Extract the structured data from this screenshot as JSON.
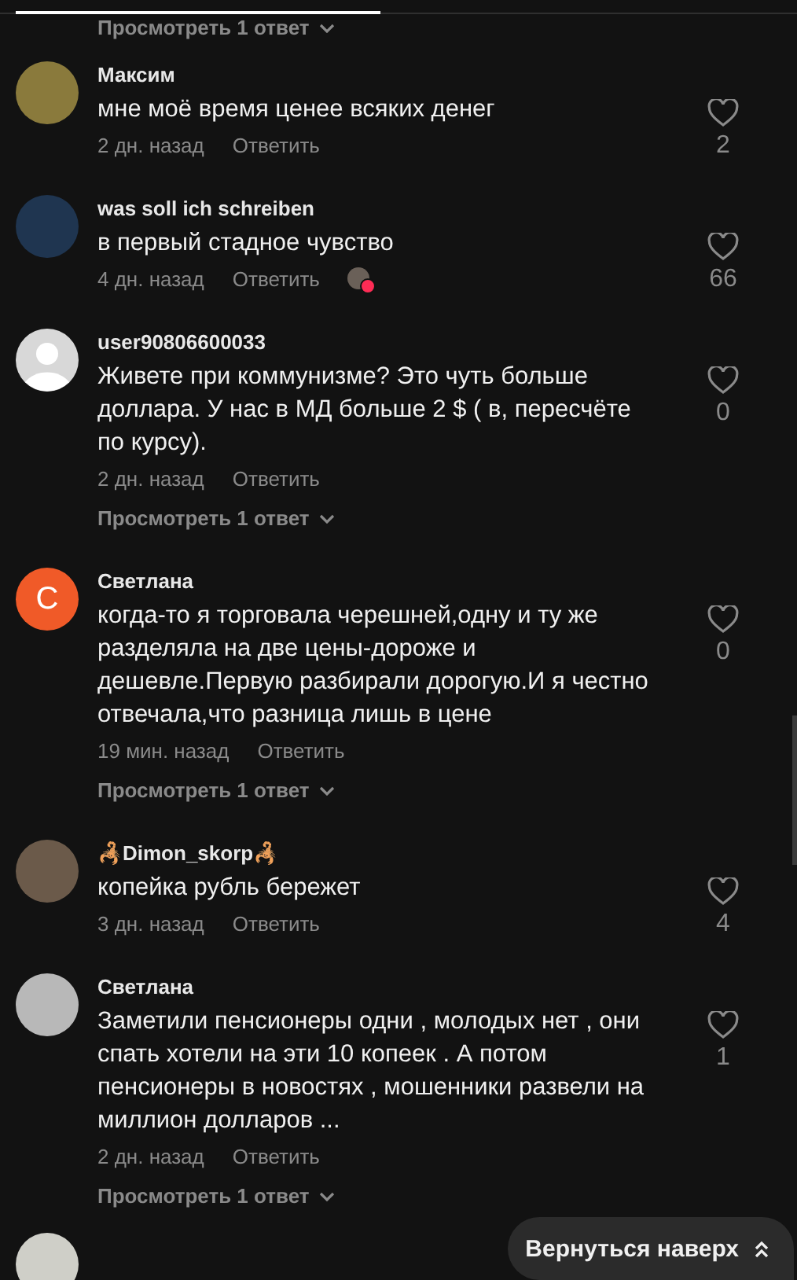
{
  "top_replies_link": "Просмотреть 1 ответ",
  "comments": [
    {
      "author": "Максим",
      "avatar": {
        "kind": "photo",
        "color": "#8a7a3c"
      },
      "text": "мне моё время ценее всяких денег",
      "time": "2 дн. назад",
      "reply": "Ответить",
      "likes": "2",
      "liked_by_creator": false
    },
    {
      "author": "was soll ich schreiben",
      "avatar": {
        "kind": "photo",
        "color": "#1f3550"
      },
      "text": "в первый стадное чувство",
      "time": "4 дн. назад",
      "reply": "Ответить",
      "likes": "66",
      "liked_by_creator": true
    },
    {
      "author": "user90806600033",
      "avatar": {
        "kind": "default"
      },
      "text": "Живете при коммунизме? Это чуть больше доллара. У нас в МД больше 2 $ ( в, пересчёте по курсу).",
      "time": "2 дн. назад",
      "reply": "Ответить",
      "likes": "0",
      "liked_by_creator": false,
      "replies_link": "Просмотреть 1 ответ"
    },
    {
      "author": "Светлана",
      "avatar": {
        "kind": "letter",
        "letter": "С",
        "color": "#f05a28"
      },
      "text": "когда-то я торговала черешней,одну и ту же разделяла на две цены-дороже и дешевле.Первую разбирали дорогую.И я честно отвечала,что разница лишь в цене",
      "time": "19 мин. назад",
      "reply": "Ответить",
      "likes": "0",
      "liked_by_creator": false,
      "replies_link": "Просмотреть 1 ответ"
    },
    {
      "author": "🦂Dimon_skorp🦂",
      "avatar": {
        "kind": "photo",
        "color": "#6b5a4a"
      },
      "text": "копейка рубль бережет",
      "time": "3 дн. назад",
      "reply": "Ответить",
      "likes": "4",
      "liked_by_creator": false
    },
    {
      "author": "Светлана",
      "avatar": {
        "kind": "photo",
        "color": "#b8b8b8"
      },
      "text": "Заметили пенсионеры одни , молодых нет , они спать хотели на эти 10 копеек . А потом пенсионеры в новостях , мошенники развели на миллион долларов ...",
      "time": "2 дн. назад",
      "reply": "Ответить",
      "likes": "1",
      "liked_by_creator": false,
      "replies_link": "Просмотреть 1 ответ"
    }
  ],
  "next_comment_avatar": {
    "kind": "photo",
    "color": "#cfcfc8"
  },
  "back_to_top": "Вернуться наверх"
}
